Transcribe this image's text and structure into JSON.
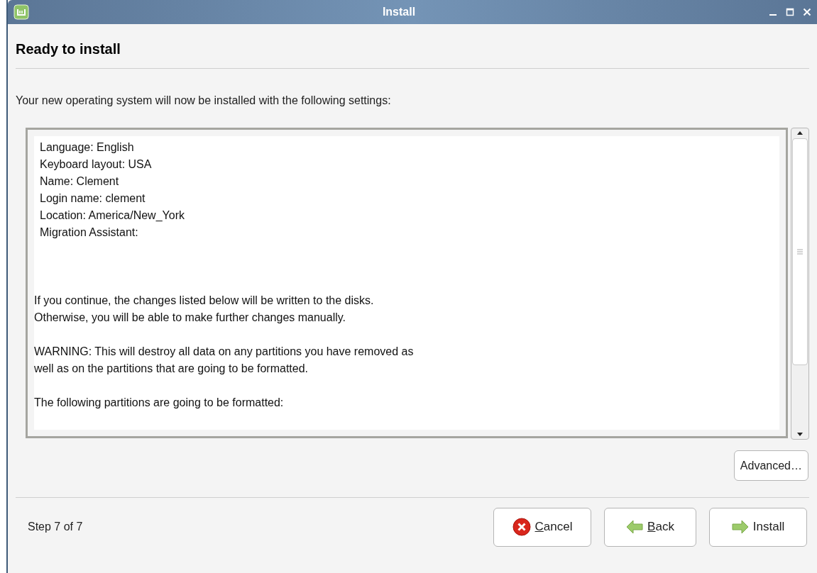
{
  "window": {
    "title": "Install"
  },
  "heading": "Ready to install",
  "intro": "Your new operating system will now be installed with the following settings:",
  "summary": {
    "settings": [
      "Language: English",
      "Keyboard layout: USA",
      "Name: Clement",
      "Login name: clement",
      "Location: America/New_York",
      "Migration Assistant:"
    ],
    "paragraphs": [
      [
        "If you continue, the changes listed below will be written to the disks.",
        "Otherwise, you will be able to make further changes manually."
      ],
      [
        "WARNING: This will destroy all data on any partitions you have removed as",
        "well as on the partitions that are going to be formatted."
      ],
      [
        "The following partitions are going to be formatted:"
      ]
    ]
  },
  "advanced_button": "Advanced…",
  "step": "Step 7 of 7",
  "buttons": [
    {
      "kind": "cancel",
      "label": "Cancel",
      "mnemonic": true
    },
    {
      "kind": "back",
      "label": "Back",
      "mnemonic": true
    },
    {
      "kind": "install",
      "label": "Install",
      "mnemonic": false
    }
  ]
}
